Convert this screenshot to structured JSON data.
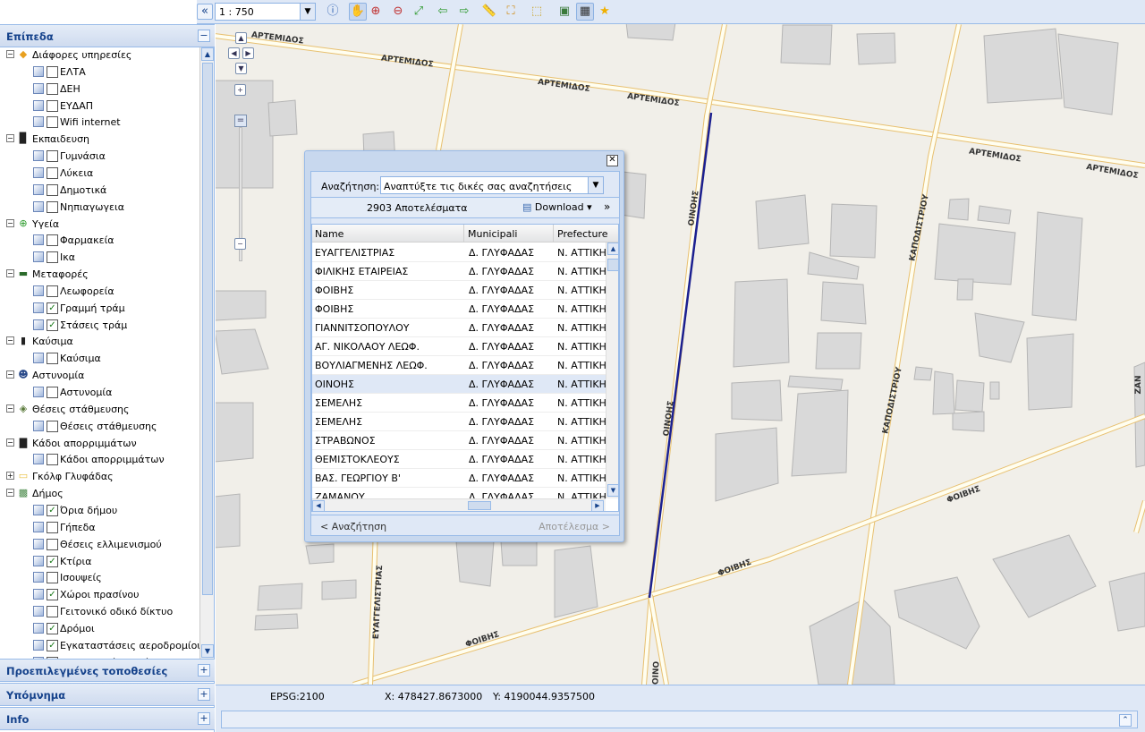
{
  "toolbar": {
    "collapse_glyph": "«",
    "scale_value": "1 : 750",
    "tools": [
      {
        "name": "info-tool-icon",
        "glyph": "ⓘ",
        "color": "#2a5db0"
      },
      {
        "name": "pan-hand-icon",
        "glyph": "✋",
        "color": "#333333"
      },
      {
        "name": "zoom-in-tool-icon",
        "glyph": "⊕",
        "color": "#c03030"
      },
      {
        "name": "zoom-out-tool-icon",
        "glyph": "⊖",
        "color": "#c03030"
      },
      {
        "name": "zoom-extent-icon",
        "glyph": "⤢",
        "color": "#2f9a2f"
      },
      {
        "name": "back-arrow-icon",
        "glyph": "⇦",
        "color": "#2f9a2f"
      },
      {
        "name": "forward-arrow-icon",
        "glyph": "⇨",
        "color": "#2f9a2f"
      },
      {
        "name": "measure-distance-icon",
        "glyph": "📏",
        "color": "#d08a10"
      },
      {
        "name": "measure-area-icon",
        "glyph": "⛶",
        "color": "#d08a10"
      },
      {
        "name": "select-tool-icon",
        "glyph": "⬚",
        "color": "#c8a020"
      },
      {
        "name": "print-map-icon",
        "glyph": "▣",
        "color": "#3a7a3a"
      },
      {
        "name": "layers-grid-icon",
        "glyph": "▦",
        "color": "#333333"
      },
      {
        "name": "favorite-star-icon",
        "glyph": "★",
        "color": "#f0b000"
      }
    ]
  },
  "sidebar": {
    "layers_title": "Επίπεδα",
    "collapse_glyph": "−",
    "expand_glyph": "+",
    "tree": [
      {
        "type": "group",
        "label": "Διάφορες υπηρεσίες",
        "icon": "services-icon",
        "glyph": "◆",
        "color": "#e8a020",
        "expanded": true
      },
      {
        "type": "layer",
        "label": "ΕΛΤΑ",
        "checked": false
      },
      {
        "type": "layer",
        "label": "ΔΕΗ",
        "checked": false
      },
      {
        "type": "layer",
        "label": "ΕΥΔΑΠ",
        "checked": false
      },
      {
        "type": "layer",
        "label": "Wifi internet",
        "checked": false
      },
      {
        "type": "group",
        "label": "Εκπαιδευση",
        "icon": "education-icon",
        "glyph": "▉",
        "color": "#222222",
        "expanded": true
      },
      {
        "type": "layer",
        "label": "Γυμνάσια",
        "checked": false
      },
      {
        "type": "layer",
        "label": "Λύκεια",
        "checked": false
      },
      {
        "type": "layer",
        "label": "Δημοτικά",
        "checked": false
      },
      {
        "type": "layer",
        "label": "Νηπιαγωγεια",
        "checked": false
      },
      {
        "type": "group",
        "label": "Υγεία",
        "icon": "health-cross-icon",
        "glyph": "⊕",
        "color": "#2a9a2a",
        "expanded": true
      },
      {
        "type": "layer",
        "label": "Φαρμακεία",
        "checked": false
      },
      {
        "type": "layer",
        "label": "Ικα",
        "checked": false
      },
      {
        "type": "group",
        "label": "Μεταφορές",
        "icon": "transport-truck-icon",
        "glyph": "▬",
        "color": "#2a6a2a",
        "expanded": true
      },
      {
        "type": "layer",
        "label": "Λεωφορεία",
        "checked": false
      },
      {
        "type": "layer",
        "label": "Γραμμή τράμ",
        "checked": true
      },
      {
        "type": "layer",
        "label": "Στάσεις τράμ",
        "checked": true
      },
      {
        "type": "group",
        "label": "Καύσιμα",
        "icon": "fuel-pump-icon",
        "glyph": "▮",
        "color": "#222222",
        "expanded": true
      },
      {
        "type": "layer",
        "label": "Καύσιμα",
        "checked": false
      },
      {
        "type": "group",
        "label": "Αστυνομία",
        "icon": "police-officer-icon",
        "glyph": "☻",
        "color": "#2a4a8a",
        "expanded": true
      },
      {
        "type": "layer",
        "label": "Αστυνομία",
        "checked": false
      },
      {
        "type": "group",
        "label": "Θέσεις στάθμευσης",
        "icon": "parking-car-icon",
        "glyph": "◈",
        "color": "#5a7a3a",
        "expanded": true
      },
      {
        "type": "layer",
        "label": "Θέσεις στάθμευσης",
        "checked": false
      },
      {
        "type": "group",
        "label": "Κάδοι απορριμμάτων",
        "icon": "trash-bin-icon",
        "glyph": "▇",
        "color": "#222222",
        "expanded": true
      },
      {
        "type": "layer",
        "label": "Κάδοι απορριμμάτων",
        "checked": false
      },
      {
        "type": "group",
        "label": "Γκόλφ Γλυφάδας",
        "icon": "folder-icon",
        "glyph": "▭",
        "color": "#e8c040",
        "expanded": false
      },
      {
        "type": "group",
        "label": "Δήμος",
        "icon": "municipality-map-icon",
        "glyph": "▩",
        "color": "#4a8a4a",
        "expanded": true
      },
      {
        "type": "layer",
        "label": "Όρια δήμου",
        "checked": true
      },
      {
        "type": "layer",
        "label": "Γήπεδα",
        "checked": false
      },
      {
        "type": "layer",
        "label": "Θέσεις ελλιμενισμού",
        "checked": false
      },
      {
        "type": "layer",
        "label": "Κτίρια",
        "checked": true
      },
      {
        "type": "layer",
        "label": "Ισουψείς",
        "checked": false
      },
      {
        "type": "layer",
        "label": "Χώροι πρασίνου",
        "checked": true
      },
      {
        "type": "layer",
        "label": "Γειτονικό οδικό δίκτυο",
        "checked": false
      },
      {
        "type": "layer",
        "label": "Δρόμοι",
        "checked": true
      },
      {
        "type": "layer",
        "label": "Εγκαταστάσεις αεροδρομίου",
        "checked": true
      },
      {
        "type": "layer",
        "label": "Οικοδομικά τετράγωνα",
        "checked": false
      }
    ],
    "panels": [
      {
        "title": "Προεπιλεγμένες τοποθεσίες"
      },
      {
        "title": "Υπόμνημα"
      },
      {
        "title": "Info"
      }
    ]
  },
  "map": {
    "street_labels": [
      {
        "text": "ΑΡΤΕΜΙΔΟΣ"
      },
      {
        "text": "ΑΡΤΕΜΙΔΟΣ"
      },
      {
        "text": "ΑΡΤΕΜΙΔΟΣ"
      },
      {
        "text": "ΑΡΤΕΜΙΔΟΣ"
      },
      {
        "text": "ΑΡΤΕΜΙΔΟΣ"
      },
      {
        "text": "ΑΡΤΕΜΙΔΟΣ"
      },
      {
        "text": "ΟΙΝΟΗΣ"
      },
      {
        "text": "ΟΙΝΟΗΣ"
      },
      {
        "text": "ΟΙΝΟ"
      },
      {
        "text": "ΚΑΠΟΔΙΣΤΡΙΟΥ"
      },
      {
        "text": "ΚΑΠΟΔΙΣΤΡΙΟΥ"
      },
      {
        "text": "ΦΟΙΒΗΣ"
      },
      {
        "text": "ΦΟΙΒΗΣ"
      },
      {
        "text": "ΦΟΙΒΗΣ"
      },
      {
        "text": "ΕΥΑΓΓΕΛΙΣΤΡΙΑΣ"
      },
      {
        "text": "ΖΑΝ"
      }
    ],
    "colors": {
      "background": "#f1efe9",
      "building": "#d9d9d9",
      "road_fill": "#fffef0",
      "road_edge": "#e8c070",
      "tram": "#1c2090"
    }
  },
  "zoom": {
    "pan_up": "▲",
    "pan_left": "◀",
    "pan_right": "▶",
    "pan_down": "▼",
    "zoom_in": "+",
    "zoom_out": "−",
    "knob": "="
  },
  "dialog": {
    "close_glyph": "✕",
    "search_label": "Αναζήτηση:",
    "search_combo_value": "Αναπτύξτε τις δικές σας αναζητήσεις",
    "result_count": "2903 Αποτελέσματα",
    "download_label": "Download",
    "download_arrow": "▾",
    "more_glyph": "»",
    "columns": [
      "Name",
      "Municipali",
      "Prefecture"
    ],
    "rows": [
      [
        "ΕΥΑΓΓΕΛΙΣΤΡΙΑΣ",
        "Δ. ΓΛΥΦΑΔΑΣ",
        "Ν. ΑΤΤΙΚΗΣ"
      ],
      [
        "ΦΙΛΙΚΗΣ ΕΤΑΙΡΕΙΑΣ",
        "Δ. ΓΛΥΦΑΔΑΣ",
        "Ν. ΑΤΤΙΚΗΣ"
      ],
      [
        "ΦΟΙΒΗΣ",
        "Δ. ΓΛΥΦΑΔΑΣ",
        "Ν. ΑΤΤΙΚΗΣ"
      ],
      [
        "ΦΟΙΒΗΣ",
        "Δ. ΓΛΥΦΑΔΑΣ",
        "Ν. ΑΤΤΙΚΗΣ"
      ],
      [
        "ΓΙΑΝΝΙΤΣΟΠΟΥΛΟΥ",
        "Δ. ΓΛΥΦΑΔΑΣ",
        "Ν. ΑΤΤΙΚΗΣ"
      ],
      [
        "ΑΓ. ΝΙΚΟΛΑΟΥ ΛΕΩΦ.",
        "Δ. ΓΛΥΦΑΔΑΣ",
        "Ν. ΑΤΤΙΚΗΣ"
      ],
      [
        "ΒΟΥΛΙΑΓΜΕΝΗΣ ΛΕΩΦ.",
        "Δ. ΓΛΥΦΑΔΑΣ",
        "Ν. ΑΤΤΙΚΗΣ"
      ],
      [
        "ΟΙΝΟΗΣ",
        "Δ. ΓΛΥΦΑΔΑΣ",
        "Ν. ΑΤΤΙΚΗΣ"
      ],
      [
        "ΣΕΜΕΛΗΣ",
        "Δ. ΓΛΥΦΑΔΑΣ",
        "Ν. ΑΤΤΙΚΗΣ"
      ],
      [
        "ΣΕΜΕΛΗΣ",
        "Δ. ΓΛΥΦΑΔΑΣ",
        "Ν. ΑΤΤΙΚΗΣ"
      ],
      [
        "ΣΤΡΑΒΩΝΟΣ",
        "Δ. ΓΛΥΦΑΔΑΣ",
        "Ν. ΑΤΤΙΚΗΣ"
      ],
      [
        "ΘΕΜΙΣΤΟΚΛΕΟΥΣ",
        "Δ. ΓΛΥΦΑΔΑΣ",
        "Ν. ΑΤΤΙΚΗΣ"
      ],
      [
        "ΒΑΣ. ΓΕΩΡΓΙΟΥ Β'",
        "Δ. ΓΛΥΦΑΔΑΣ",
        "Ν. ΑΤΤΙΚΗΣ"
      ],
      [
        "ΖΑΜΑΝΟΥ",
        "Δ. ΓΛΥΦΑΔΑΣ",
        "Ν. ΑΤΤΙΚΗΣ"
      ]
    ],
    "selected_row": 7,
    "prev_label": "< Αναζήτηση",
    "next_label": "Αποτέλεσμα >"
  },
  "status": {
    "epsg": "EPSG:2100",
    "x": "X: 478427.8673000",
    "y": "Y: 4190044.9357500"
  },
  "bottom": {
    "expand_glyph": "⌃"
  }
}
